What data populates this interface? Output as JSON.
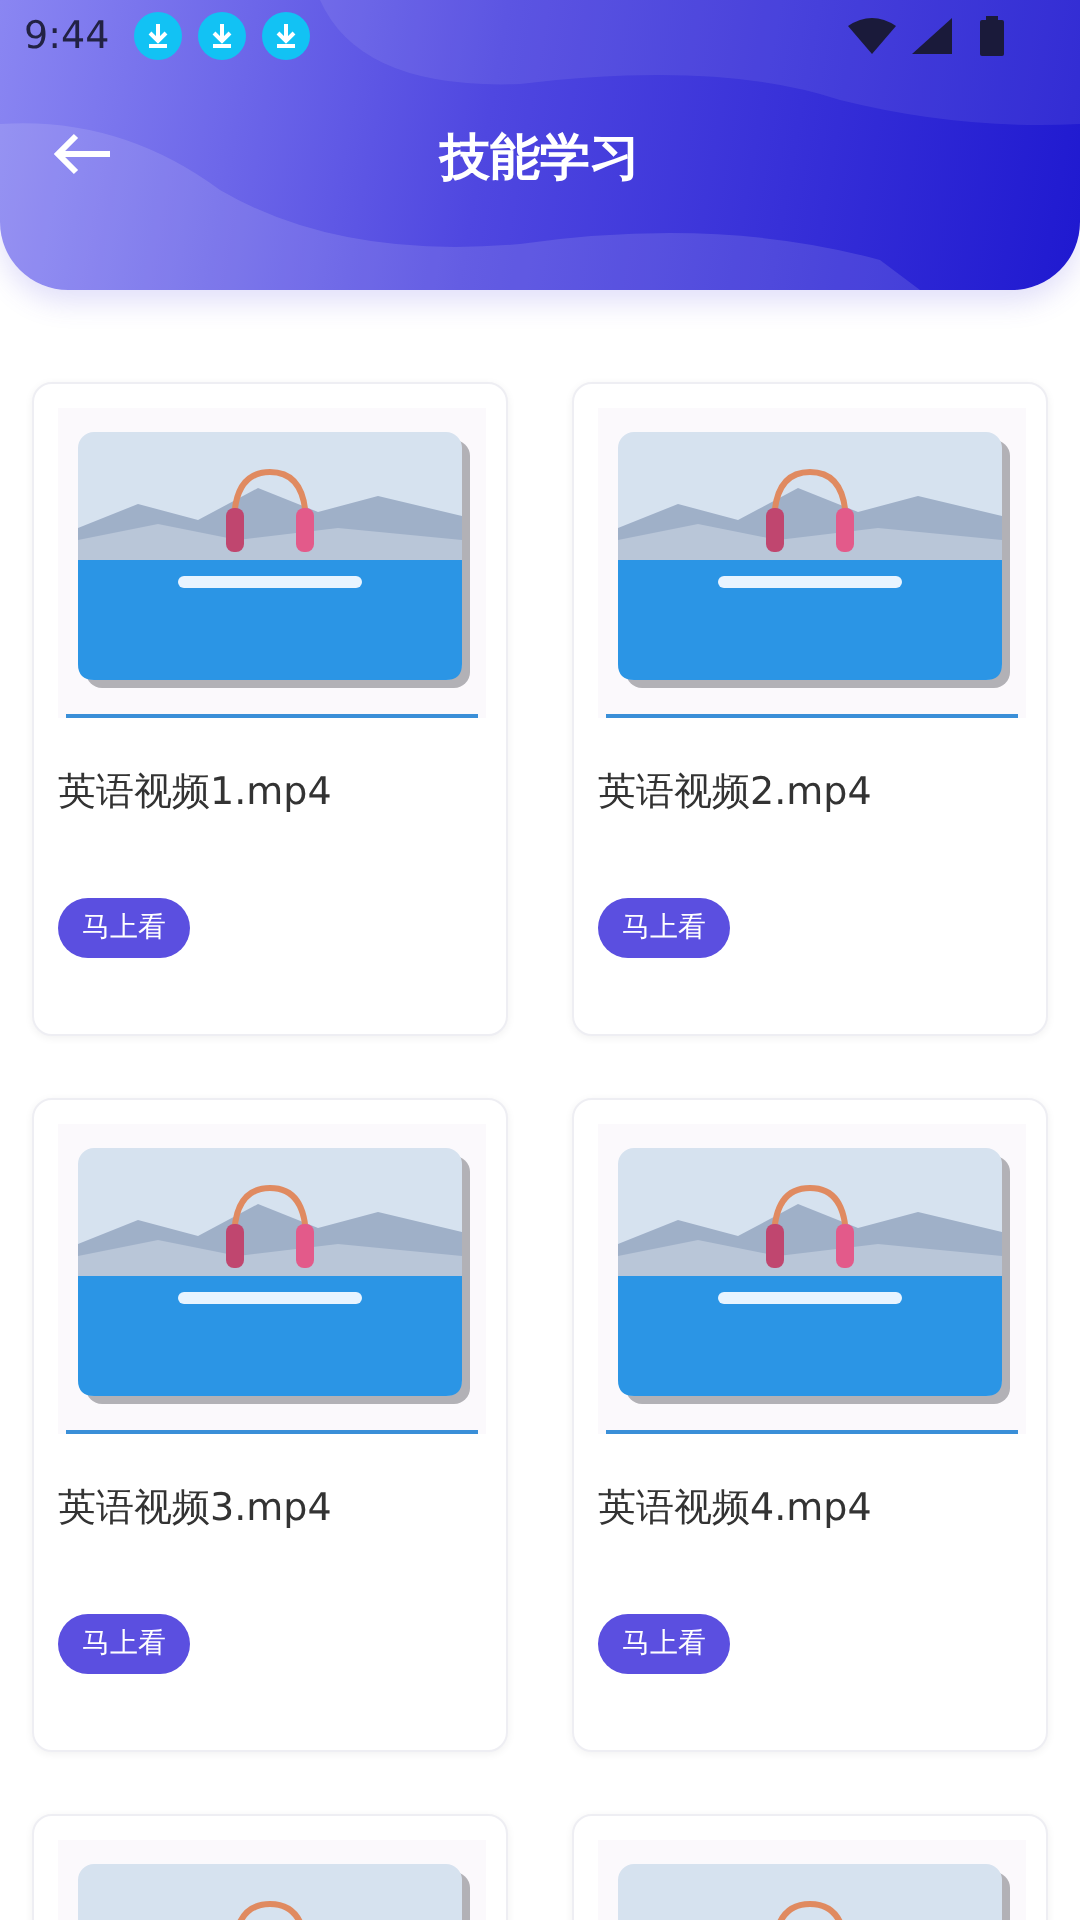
{
  "status_bar": {
    "time": "9:44",
    "notifications": [
      {
        "kind": "download"
      },
      {
        "kind": "download"
      },
      {
        "kind": "download"
      }
    ]
  },
  "header": {
    "title": "技能学习"
  },
  "videos": [
    {
      "kind": "video",
      "title": "英语视频1.mp4",
      "action": "马上看"
    },
    {
      "kind": "video",
      "title": "英语视频2.mp4",
      "action": "马上看"
    },
    {
      "kind": "video",
      "title": "英语视频3.mp4",
      "action": "马上看"
    },
    {
      "kind": "video",
      "title": "英语视频4.mp4",
      "action": "马上看"
    },
    {
      "kind": "picture"
    },
    {
      "kind": "picture"
    }
  ]
}
